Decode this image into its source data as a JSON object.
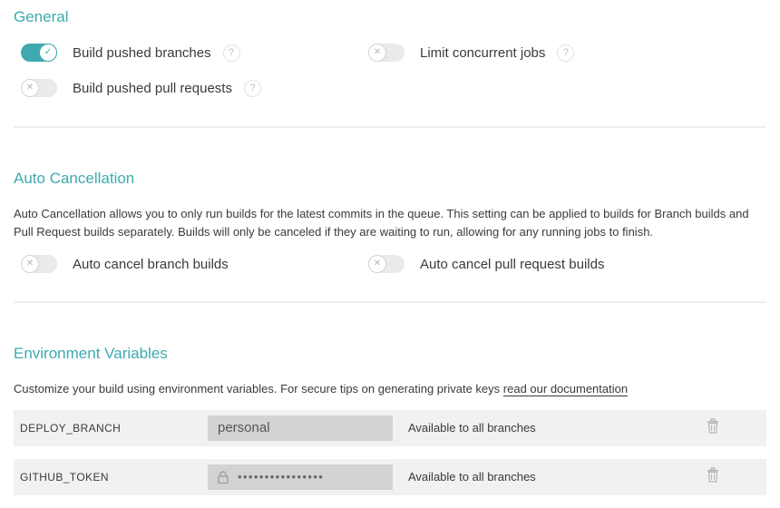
{
  "general": {
    "title": "General",
    "settings": {
      "build_pushed_branches": {
        "label": "Build pushed branches",
        "enabled": true,
        "help": "?"
      },
      "limit_concurrent_jobs": {
        "label": "Limit concurrent jobs",
        "enabled": false,
        "help": "?"
      },
      "build_pushed_pull_requests": {
        "label": "Build pushed pull requests",
        "enabled": false,
        "help": "?"
      }
    }
  },
  "auto_cancellation": {
    "title": "Auto Cancellation",
    "description": "Auto Cancellation allows you to only run builds for the latest commits in the queue. This setting can be applied to builds for Branch builds and Pull Request builds separately. Builds will only be canceled if they are waiting to run, allowing for any running jobs to finish.",
    "settings": {
      "branch_builds": {
        "label": "Auto cancel branch builds",
        "enabled": false
      },
      "pull_request_builds": {
        "label": "Auto cancel pull request builds",
        "enabled": false
      }
    }
  },
  "environment_variables": {
    "title": "Environment Variables",
    "description": "Customize your build using environment variables. For secure tips on generating private keys ",
    "link_text": "read our documentation",
    "rows": [
      {
        "name": "DEPLOY_BRANCH",
        "value": "personal",
        "secure": false,
        "scope": "Available to all branches"
      },
      {
        "name": "GITHUB_TOKEN",
        "value": "••••••••••••••••",
        "secure": true,
        "scope": "Available to all branches"
      }
    ]
  },
  "icons": {
    "toggle_on": "check-icon",
    "toggle_off": "x-icon",
    "help": "question-icon",
    "delete": "trash-icon",
    "secure": "lock-icon"
  },
  "colors": {
    "accent": "#3eaaaf",
    "row_bg": "#f1f1f1",
    "value_bg": "#d3d3d3"
  }
}
